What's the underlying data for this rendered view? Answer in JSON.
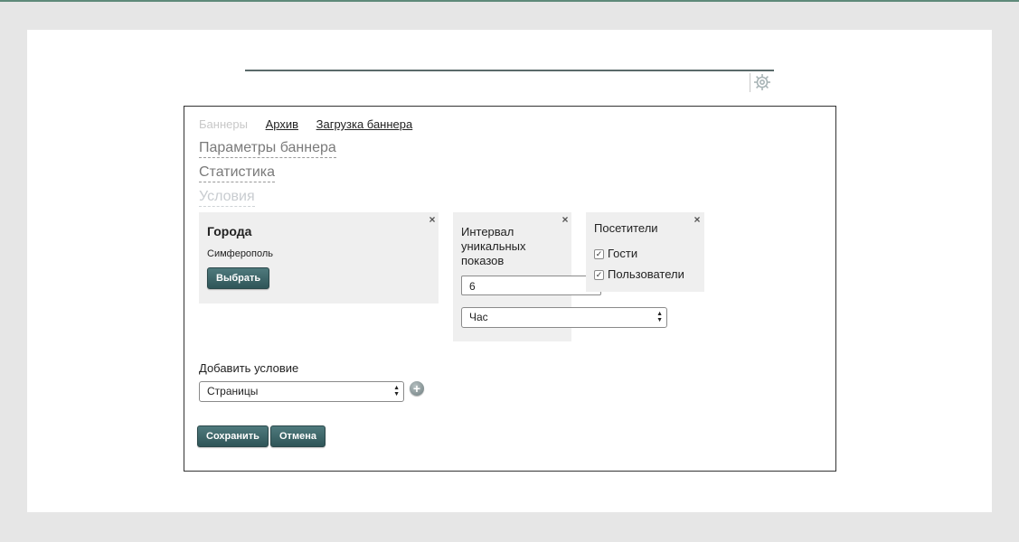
{
  "tabs": {
    "banners": "Баннеры",
    "archive": "Архив",
    "upload": "Загрузка баннера"
  },
  "sections": {
    "params": "Параметры баннера",
    "stats": "Статистика",
    "conditions": "Условия"
  },
  "cities": {
    "title": "Города",
    "city": "Симферополь",
    "choose_label": "Выбрать"
  },
  "interval": {
    "title": "Интервал уникальных показов",
    "value": "6",
    "unit": "Час"
  },
  "visitors": {
    "title": "Посетители",
    "options": [
      {
        "label": "Гости",
        "checked": true
      },
      {
        "label": "Пользователи",
        "checked": true
      }
    ]
  },
  "add_condition": {
    "label": "Добавить условие",
    "selected": "Страницы"
  },
  "actions": {
    "save_label": "Сохранить",
    "cancel_label": "Отмена"
  },
  "icons": {
    "close": "close-icon",
    "settings": "gear-icon",
    "add": "plus-icon"
  },
  "colors": {
    "button": "#3e6669",
    "box_bg": "#efefef",
    "page_bg": "#e6e6e6"
  }
}
